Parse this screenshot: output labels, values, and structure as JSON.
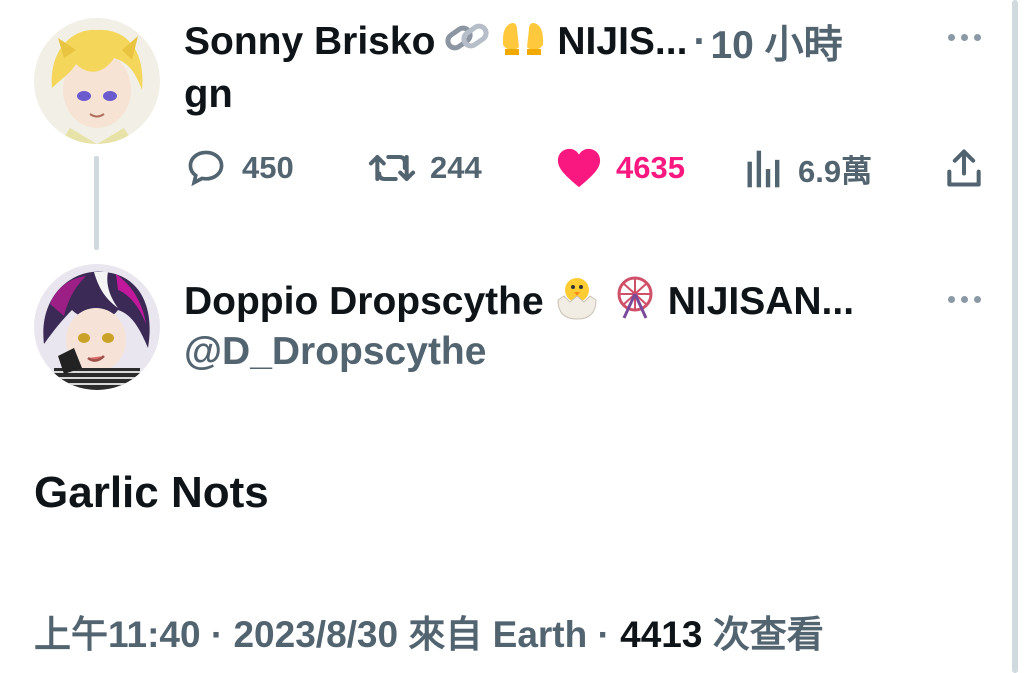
{
  "reply_tweet": {
    "display_name": "Sonny Brisko",
    "name_suffix": "NIJIS...",
    "separator": "·",
    "time_ago": "10 小時",
    "emojis": [
      "link-emoji",
      "raising-hands-emoji"
    ],
    "text": "gn",
    "actions": {
      "reply_count": "450",
      "retweet_count": "244",
      "like_count": "4635",
      "view_count": "6.9萬"
    },
    "liked": true
  },
  "quoted_tweet": {
    "display_name": "Doppio Dropscythe",
    "name_suffix": "NIJISAN...",
    "emojis": [
      "hatching-chick-emoji",
      "ferris-wheel-emoji"
    ],
    "handle": "@D_Dropscythe",
    "text": "Garlic Nots",
    "meta": {
      "time": "上午11:40",
      "sep1": " · ",
      "date": "2023/8/30",
      "source": " 來自 Earth",
      "sep2": " · ",
      "views": "4413",
      "views_label": " 次查看"
    }
  },
  "colors": {
    "like": "#f91880",
    "secondary_text": "#536471",
    "primary_text": "#0f1419",
    "thread_line": "#cfd9de"
  }
}
